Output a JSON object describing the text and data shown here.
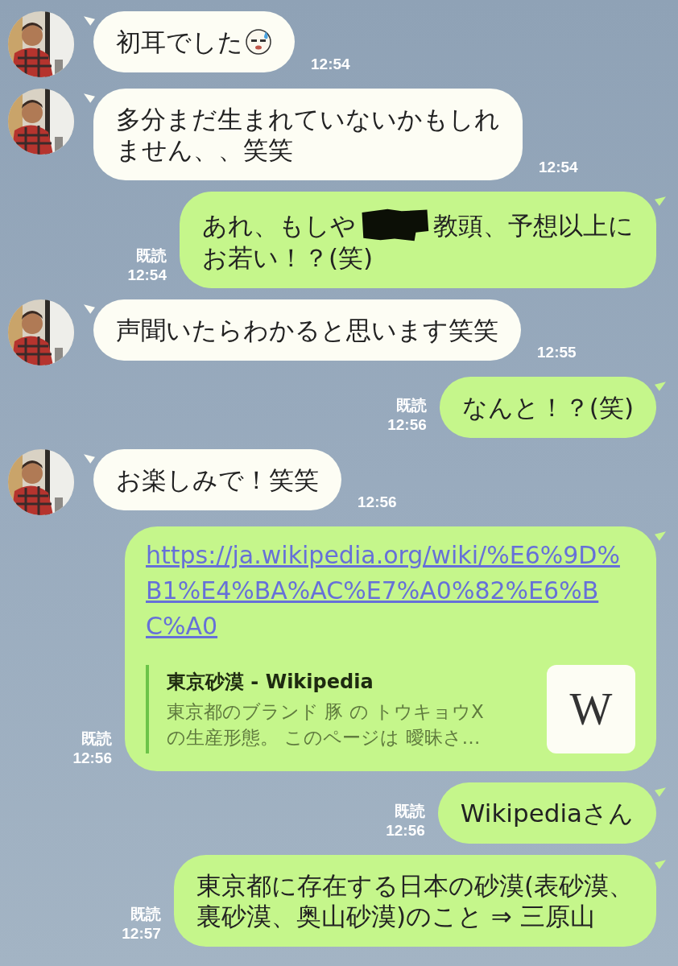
{
  "messages": [
    {
      "kind": "incoming",
      "text": "初耳でした",
      "emoji": true,
      "time": "12:54"
    },
    {
      "kind": "incoming",
      "lines": [
        "多分まだ生まれていないかもしれ",
        "ません、、笑笑"
      ],
      "time": "12:54"
    },
    {
      "kind": "outgoing",
      "parts": [
        {
          "kind": "text",
          "text": "あれ、もしや"
        },
        {
          "kind": "redaction"
        },
        {
          "kind": "text",
          "text": "教頭、予想以上に"
        },
        {
          "kind": "line_break"
        },
        {
          "kind": "text",
          "text": "お若い！？(笑)"
        }
      ],
      "read_label": "既読",
      "time": "12:54"
    },
    {
      "kind": "incoming",
      "text": "声聞いたらわかると思います笑笑",
      "time": "12:55"
    },
    {
      "kind": "outgoing",
      "text": "なんと！？(笑)",
      "read_label": "既読",
      "time": "12:56"
    },
    {
      "kind": "incoming",
      "text": "お楽しみで！笑笑",
      "time": "12:56"
    },
    {
      "kind": "link",
      "url": "https://ja.wikipedia.org/wiki/%E6%9D%B1%E4%BA%AC%E7%A0%82%E6%BC%A0",
      "preview": {
        "title": "東京砂漠 - Wikipedia",
        "description": "東京都のブランド 豚 の トウキョウX\nの生産形態。 このページは 曖昧さ…",
        "thumbnail": "W"
      },
      "read_label": "既読",
      "time": "12:56"
    },
    {
      "kind": "outgoing",
      "text": "Wikipediaさん",
      "read_label": "既読",
      "time": "12:56"
    },
    {
      "kind": "outgoing",
      "lines": [
        "東京都に存在する日本の砂漠(表砂漠、",
        "裏砂漠、奥山砂漠)のこと ⇒ 三原山"
      ],
      "read_label": "既読",
      "time": "12:57"
    }
  ]
}
